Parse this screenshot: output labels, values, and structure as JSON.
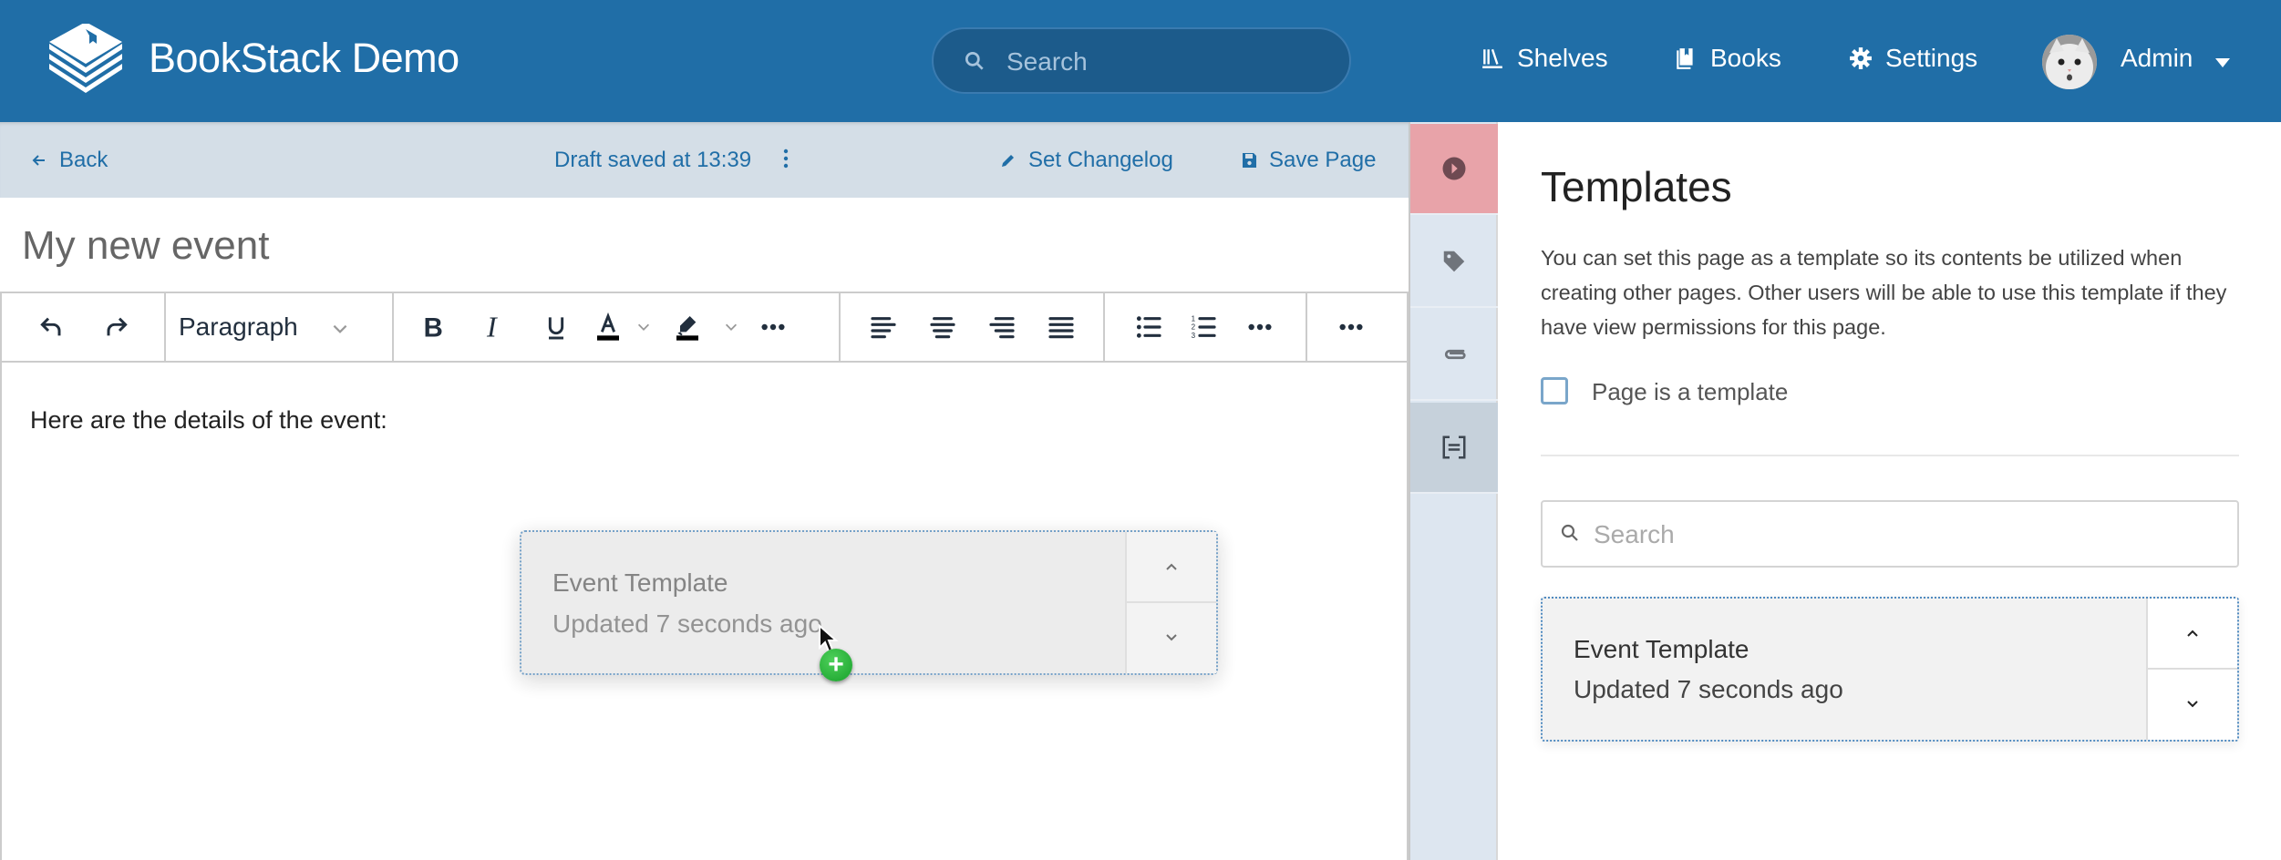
{
  "header": {
    "app_title": "BookStack Demo",
    "search_placeholder": "Search",
    "nav": [
      {
        "label": "Shelves",
        "icon": "shelves-icon"
      },
      {
        "label": "Books",
        "icon": "books-icon"
      },
      {
        "label": "Settings",
        "icon": "gear-icon"
      }
    ],
    "user": {
      "name": "Admin",
      "avatar": "cat-avatar"
    },
    "brand_color": "#206ea7"
  },
  "editor_bar": {
    "back_label": "Back",
    "draft_status": "Draft saved at 13:39",
    "set_changelog_label": "Set Changelog",
    "save_label": "Save Page"
  },
  "page": {
    "title": "My new event",
    "body_text": "Here are the details of the event:"
  },
  "toolbar": {
    "block_format": "Paragraph",
    "buttons": [
      "undo",
      "redo",
      "bold",
      "italic",
      "underline",
      "text-color",
      "highlight-color",
      "more-formatting",
      "align-left",
      "align-center",
      "align-right",
      "align-justify",
      "bulleted-list",
      "numbered-list",
      "more-lists",
      "more"
    ]
  },
  "drag_ghost": {
    "name": "Event Template",
    "meta": "Updated 7 seconds ago"
  },
  "sidebar_tabs": [
    {
      "name": "toggle-sidebar",
      "icon": "play-circle-icon",
      "state": "highlight"
    },
    {
      "name": "tags",
      "icon": "tag-icon"
    },
    {
      "name": "attachments",
      "icon": "paperclip-icon"
    },
    {
      "name": "templates",
      "icon": "template-icon",
      "state": "active"
    }
  ],
  "templates_panel": {
    "heading": "Templates",
    "description": "You can set this page as a template so its contents be utilized when creating other pages. Other users will be able to use this template if they have view permissions for this page.",
    "checkbox_label": "Page is a template",
    "checkbox_checked": false,
    "search_placeholder": "Search",
    "items": [
      {
        "name": "Event Template",
        "meta": "Updated 7 seconds ago"
      }
    ]
  }
}
